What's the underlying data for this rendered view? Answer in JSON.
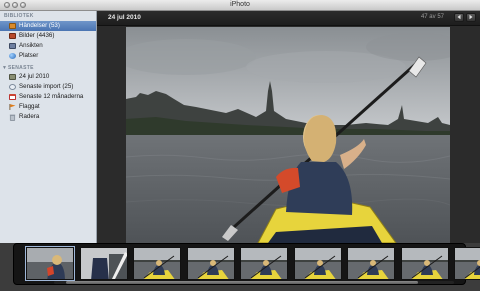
{
  "window": {
    "title": "iPhoto"
  },
  "sidebar": {
    "library_header": "BIBLIOTEK",
    "library_items": [
      {
        "label": "Händelser (53)",
        "icon": "events-icon",
        "selected": true
      },
      {
        "label": "Bilder (4436)",
        "icon": "photos-icon",
        "selected": false
      },
      {
        "label": "Ansikten",
        "icon": "faces-icon",
        "selected": false
      },
      {
        "label": "Platser",
        "icon": "places-icon",
        "selected": false
      }
    ],
    "recent_header": "SENASTE",
    "recent_items": [
      {
        "label": "24 jul 2010",
        "icon": "event-icon"
      },
      {
        "label": "Senaste import (25)",
        "icon": "import-icon"
      },
      {
        "label": "Senaste 12 månaderna",
        "icon": "calendar-icon"
      },
      {
        "label": "Flaggat",
        "icon": "flag-icon"
      },
      {
        "label": "Radera",
        "icon": "trash-icon"
      }
    ]
  },
  "toolbar": {
    "event_title": "24 jul 2010",
    "counter": "47 av 57",
    "prev_icon": "arrow-left-icon",
    "next_icon": "arrow-right-icon"
  },
  "filmstrip": {
    "thumbnail_count": 9,
    "selected_index": 0
  },
  "colors": {
    "selection": "#4a74b2",
    "sidebar_bg": "#dde3ea",
    "viewer_bg": "#2b2b2b",
    "kayak": "#e7d43c"
  }
}
